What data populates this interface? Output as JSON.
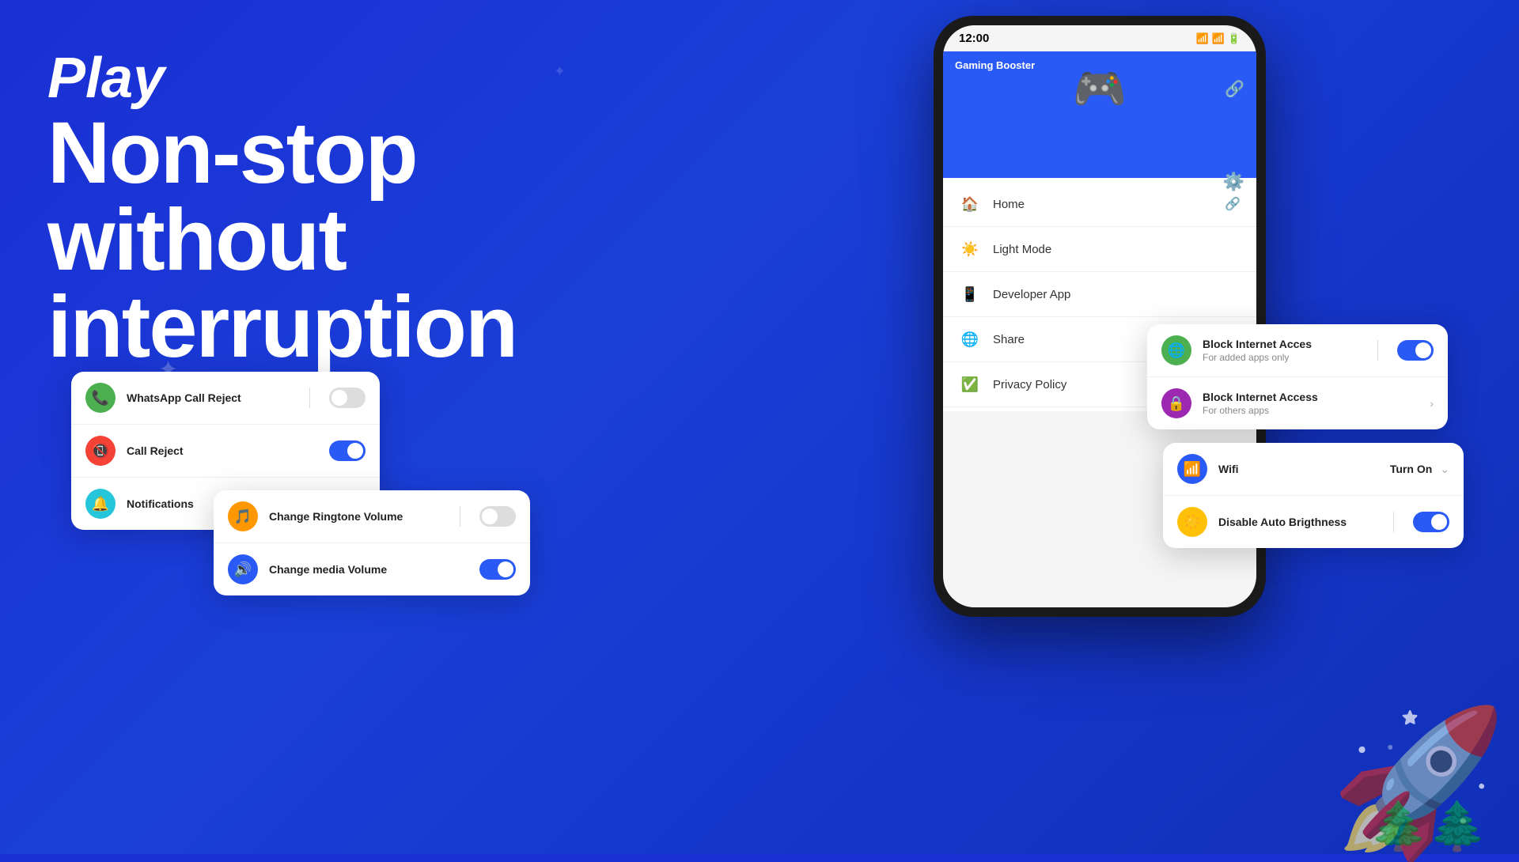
{
  "hero": {
    "play_label": "Play",
    "main_text_line1": "Non-stop",
    "main_text_line2": "without",
    "main_text_line3": "interruption"
  },
  "phone": {
    "time": "12:00",
    "app_name": "Gaming Booster",
    "menu_items": [
      {
        "id": "home",
        "label": "Home",
        "icon": "🏠"
      },
      {
        "id": "light_mode",
        "label": "Light Mode",
        "icon": "☀️"
      },
      {
        "id": "developer_app",
        "label": "Developer App",
        "icon": "🎮"
      },
      {
        "id": "share",
        "label": "Share",
        "icon": "🌐"
      },
      {
        "id": "privacy_policy",
        "label": "Privacy Policy",
        "icon": "✅"
      }
    ]
  },
  "card_calls": {
    "rows": [
      {
        "id": "whatsapp",
        "label": "WhatsApp Call Reject",
        "icon_color": "green",
        "icon": "📞",
        "toggle": false
      },
      {
        "id": "call_reject",
        "label": "Call Reject",
        "icon_color": "red",
        "icon": "📵",
        "toggle": true
      },
      {
        "id": "notifications",
        "label": "Notifications",
        "icon_color": "teal",
        "icon": "🔔",
        "toggle": null
      }
    ]
  },
  "card_volume": {
    "rows": [
      {
        "id": "ringtone",
        "label": "Change Ringtone Volume",
        "icon_color": "orange",
        "icon": "🎵",
        "toggle": false
      },
      {
        "id": "media",
        "label": "Change media Volume",
        "icon_color": "blue",
        "icon": "🔊",
        "toggle": true
      }
    ]
  },
  "card_internet": {
    "rows": [
      {
        "id": "block_internet",
        "label": "Block Internet Acces",
        "subtitle": "For added apps only",
        "icon_color": "green",
        "icon": "🌐",
        "toggle": true,
        "type": "toggle"
      },
      {
        "id": "block_others",
        "label": "Block Internet Access",
        "subtitle": "For others apps",
        "icon_color": "purple",
        "icon": "🔒",
        "type": "arrow"
      }
    ]
  },
  "card_wifi": {
    "rows": [
      {
        "id": "wifi",
        "label": "Wifi",
        "action": "Turn On",
        "icon_color": "blue",
        "icon": "📶",
        "type": "dropdown"
      },
      {
        "id": "brightness",
        "label": "Disable Auto Brigthness",
        "icon_color": "yellow",
        "icon": "☀️",
        "toggle": true,
        "type": "toggle"
      }
    ]
  }
}
